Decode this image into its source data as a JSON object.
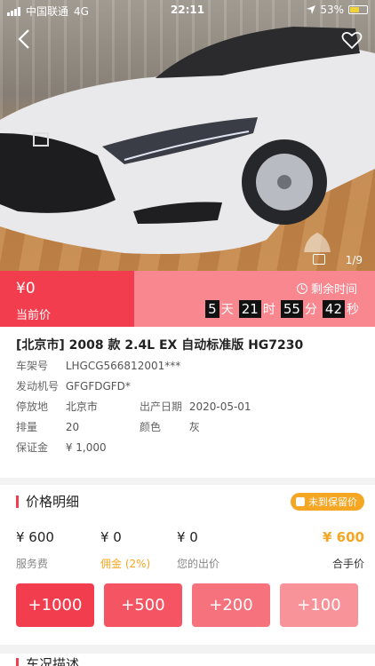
{
  "status_bar": {
    "carrier": "中国联通",
    "network": "4G",
    "time": "22:11",
    "battery": "53%",
    "battery_level": 0.53
  },
  "photo": {
    "counter": "1/9"
  },
  "auction": {
    "price": "¥0",
    "price_label": "当前价",
    "remaining_label": "剩余时间",
    "countdown": {
      "days": "5",
      "days_unit": "天",
      "hours": "21",
      "hours_unit": "时",
      "minutes": "55",
      "minutes_unit": "分",
      "seconds": "42",
      "seconds_unit": "秒"
    }
  },
  "vehicle": {
    "title": "[北京市] 2008 款 2.4L EX 自动标准版 HG7230",
    "vin_label": "车架号",
    "vin": "LHGCG566812001***",
    "engine_label": "发动机号",
    "engine": "GFGFDGFD*",
    "location_label": "停放地",
    "location": "北京市",
    "prod_date_label": "出产日期",
    "prod_date": "2020-05-01",
    "displacement_label": "排量",
    "displacement": "20",
    "color_label": "颜色",
    "color": "灰",
    "deposit_label": "保证金",
    "deposit": "¥ 1,000"
  },
  "price_detail": {
    "title": "价格明细",
    "reserve_badge": "未到保留价",
    "service_fee": "¥ 600",
    "service_fee_label": "服务费",
    "commission": "¥ 0",
    "commission_label": "佣金 (2%)",
    "your_bid": "¥ 0",
    "your_bid_label": "您的出价",
    "total": "¥ 600",
    "total_label": "合手价"
  },
  "bid_buttons": [
    {
      "label": "+1000",
      "color": "#f23d4e"
    },
    {
      "label": "+500",
      "color": "#f55563"
    },
    {
      "label": "+200",
      "color": "#f6727d"
    },
    {
      "label": "+100",
      "color": "#f8939a"
    }
  ],
  "next_section": {
    "title": "车况描述"
  }
}
